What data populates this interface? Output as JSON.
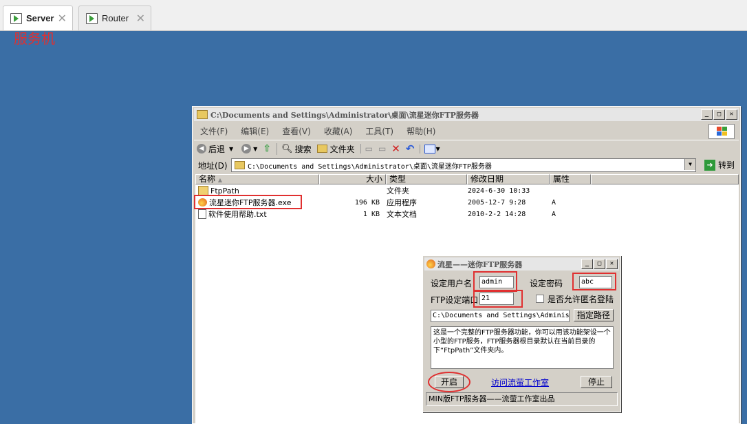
{
  "tabs": [
    {
      "label": "Server",
      "active": true
    },
    {
      "label": "Router",
      "active": false
    }
  ],
  "vm_label": "服务机",
  "explorer": {
    "title": "C:\\Documents and Settings\\Administrator\\桌面\\流星迷你FTP服务器",
    "menu": [
      "文件(F)",
      "编辑(E)",
      "查看(V)",
      "收藏(A)",
      "工具(T)",
      "帮助(H)"
    ],
    "toolbar": {
      "back": "后退",
      "search": "搜索",
      "folders": "文件夹"
    },
    "address_label": "地址(D)",
    "address_value": "C:\\Documents and Settings\\Administrator\\桌面\\流星迷你FTP服务器",
    "goto_label": "转到",
    "columns": [
      "名称",
      "大小",
      "类型",
      "修改日期",
      "属性"
    ],
    "files": [
      {
        "name": "FtpPath",
        "size": "",
        "type": "文件夹",
        "date": "2024-6-30 10:33",
        "attr": ""
      },
      {
        "name": "流星迷你FTP服务器.exe",
        "size": "196 KB",
        "type": "应用程序",
        "date": "2005-12-7 9:28",
        "attr": "A"
      },
      {
        "name": "软件使用帮助.txt",
        "size": "1 KB",
        "type": "文本文档",
        "date": "2010-2-2 14:28",
        "attr": "A"
      }
    ]
  },
  "ftp_dialog": {
    "title": "流星——迷你FTP服务器",
    "username_label": "设定用户名",
    "username_value": "admin",
    "password_label": "设定密码",
    "password_value": "abc",
    "port_label": "FTP设定端口",
    "port_value": "21",
    "anon_label": "是否允许匿名登陆",
    "path_value": "C:\\Documents and Settings\\Adminis",
    "path_button": "指定路径",
    "description": "这是一个完整的FTP服务器功能，你可以用该功能架设一个小型的FTP服务，FTP服务器根目录默认在当前目录的下“FtpPath”文件夹内。",
    "start_button": "开启",
    "link_label": "访问流萤工作室",
    "stop_button": "停止",
    "status": "MIN版FTP服务器——流萤工作室出品"
  },
  "colors": {
    "desktop": "#3a6ea5",
    "highlight": "#e03030"
  }
}
